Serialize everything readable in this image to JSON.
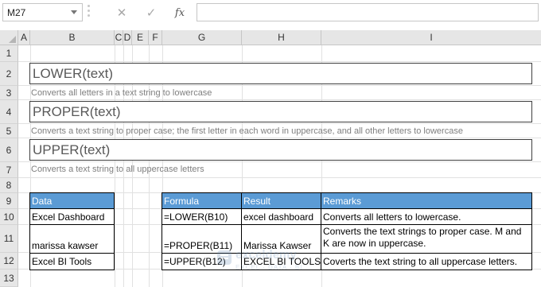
{
  "formula_bar": {
    "name_box": "M27",
    "cancel_icon": "✕",
    "enter_icon": "✓",
    "fx_label": "fx",
    "formula_value": ""
  },
  "columns": [
    "A",
    "B",
    "C",
    "D",
    "E",
    "F",
    "G",
    "H",
    "I"
  ],
  "rows": [
    "1",
    "2",
    "3",
    "4",
    "5",
    "6",
    "7",
    "8",
    "9",
    "10",
    "11",
    "12",
    "13"
  ],
  "functions": [
    {
      "syntax": "LOWER(text)",
      "description": "Converts all letters in a text string to lowercase"
    },
    {
      "syntax": "PROPER(text)",
      "description": "Converts a text string to proper case; the first letter in each word in uppercase, and all other letters to lowercase"
    },
    {
      "syntax": "UPPER(text)",
      "description": "Converts a text string to all uppercase letters"
    }
  ],
  "data_table": {
    "header": "Data",
    "rows": [
      "Excel Dashboard",
      "marissa kawser",
      "Excel BI Tools"
    ]
  },
  "results_table": {
    "headers": [
      "Formula",
      "Result",
      "Remarks"
    ],
    "rows": [
      [
        "=LOWER(B10)",
        "excel dashboard",
        "Converts all letters to lowercase."
      ],
      [
        "=PROPER(B11)",
        "Marissa Kawser",
        "Converts the text strings to proper case. M and K are now in uppercase."
      ],
      [
        "=UPPER(B12)",
        "EXCEL BI TOOLS",
        "Coverts the text string to all uppercase letters."
      ]
    ]
  },
  "watermark": {
    "title": "exceldemy",
    "subtitle": "EXCEL · DATA · BI"
  },
  "colors": {
    "table_header": "#5b9bd5",
    "header_bg": "#e6e6e6",
    "gridline": "#e1e1e1"
  }
}
